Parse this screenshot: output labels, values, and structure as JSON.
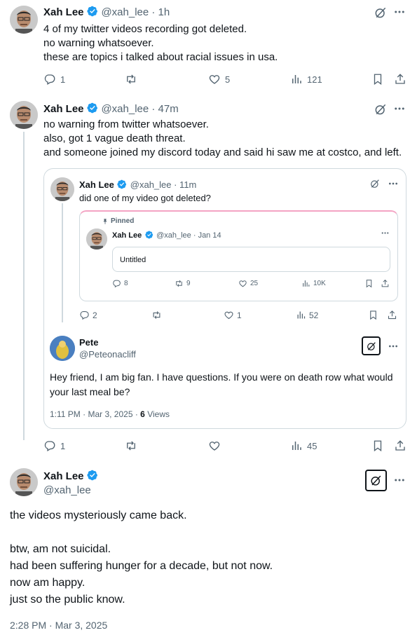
{
  "tweet1": {
    "name": "Xah Lee",
    "handle": "@xah_lee · 1h",
    "lines": [
      "4 of my twitter videos recording got deleted.",
      "no warning whatsoever.",
      "these are topics i talked about racial issues in usa."
    ],
    "replies": "1",
    "retweets": "",
    "likes": "5",
    "views": "121"
  },
  "tweet2": {
    "name": "Xah Lee",
    "handle": "@xah_lee · 47m",
    "lines": [
      "no warning from twitter whatsoever.",
      "also, got 1 vague death threat.",
      "and someone joined my discord today and said hi saw me at costco, and left."
    ],
    "replies": "1",
    "retweets": "",
    "likes": "",
    "views": "45"
  },
  "quote": {
    "name": "Xah Lee",
    "handle": "@xah_lee · 11m",
    "text": "did one of my video got deleted?",
    "replies": "2",
    "retweets": "",
    "likes": "1",
    "views": "52",
    "pinned": {
      "pinned_label": "Pinned",
      "name": "Xah Lee",
      "handle": "@xah_lee · Jan 14",
      "box_text": "Untitled",
      "replies": "8",
      "retweets": "9",
      "likes": "25",
      "views": "10K"
    },
    "reply": {
      "name": "Pete",
      "handle": "@Peteonacliff",
      "text": "Hey friend, I am big fan. I have questions. If you were on death row what would your last meal be?",
      "time": "1:11 PM · Mar 3, 2025 · ",
      "views_count": "6",
      "views_label": " Views"
    }
  },
  "main": {
    "name": "Xah Lee",
    "handle": "@xah_lee",
    "line1": "the videos mysteriously came back.",
    "lines": [
      "btw, am not suicidal.",
      "had been suffering hunger for a decade, but not now.",
      "now am happy.",
      "just so the public know."
    ],
    "time": "2:28 PM · Mar 3, 2025"
  },
  "colors": {
    "verified": "#1d9bf0",
    "text": "#0f1419",
    "muted": "#536471",
    "border": "#cfd9de",
    "pink": "#f4a3c3"
  }
}
